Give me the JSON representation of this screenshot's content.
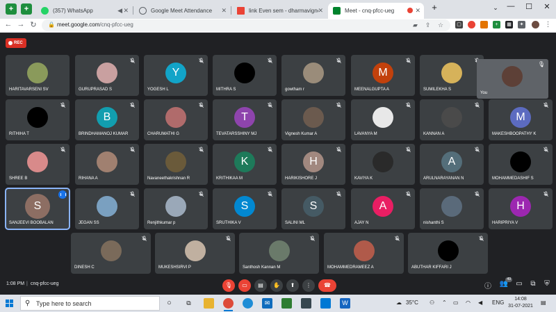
{
  "browser": {
    "tabs": [
      {
        "label": "(357) WhatsApp",
        "favicon_color": "#25d366",
        "active": false
      },
      {
        "label": "Google Meet Attendance",
        "favicon_color": "#5f6368",
        "active": false
      },
      {
        "label": "link Even sem - dharmavigneshg",
        "favicon_color": "#ea4335",
        "active": false
      },
      {
        "label": "Meet - cnq-pfcc-ueg",
        "favicon_color": "#00832d",
        "active": true
      }
    ],
    "new_tab": "+",
    "url_host": "meet.google.com",
    "url_path": "/cnq-pfcc-ueg"
  },
  "meet": {
    "recording_label": "REC",
    "self_label": "You",
    "meeting_time": "1:08 PM",
    "separator": "|",
    "meeting_code": "cnq-pfcc-ueg",
    "participants_count": "49",
    "participants": [
      {
        "name": "HARITAVARSENI SV",
        "avatar": "",
        "color": "#8a9a5b",
        "photo": true,
        "muted": false
      },
      {
        "name": "GURUPRASAD S",
        "avatar": "",
        "color": "#c9a0a0",
        "photo": true,
        "muted": true
      },
      {
        "name": "YOGESH L",
        "avatar": "Y",
        "color": "#12a4c8",
        "photo": false,
        "muted": true
      },
      {
        "name": "MITHRA S",
        "avatar": "",
        "color": "#000000",
        "photo": true,
        "muted": true
      },
      {
        "name": "gowtham r",
        "avatar": "",
        "color": "#9a8c7a",
        "photo": true,
        "muted": true
      },
      {
        "name": "MEENALGUPTA A",
        "avatar": "M",
        "color": "#c2410c",
        "photo": false,
        "muted": true
      },
      {
        "name": "SUMILEKHA S",
        "avatar": "",
        "color": "#d6b25a",
        "photo": true,
        "muted": true
      },
      {
        "name": "RITHIHA T",
        "avatar": "",
        "color": "#000000",
        "photo": true,
        "muted": true
      },
      {
        "name": "BRINDHAMANOJ KUMAR",
        "avatar": "B",
        "color": "#129eaf",
        "photo": false,
        "muted": true
      },
      {
        "name": "CHARUMATHI G",
        "avatar": "",
        "color": "#b06b6b",
        "photo": true,
        "muted": true
      },
      {
        "name": "TEVATARSSHINY MJ",
        "avatar": "T",
        "color": "#8e44ad",
        "photo": false,
        "muted": true
      },
      {
        "name": "Vignesh Kumar A",
        "avatar": "",
        "color": "#6b5a4e",
        "photo": true,
        "muted": true
      },
      {
        "name": "LAVANYA M",
        "avatar": "",
        "color": "#e8e8e8",
        "photo": true,
        "muted": true
      },
      {
        "name": "KANNAN A",
        "avatar": "",
        "color": "#4a4a4a",
        "photo": true,
        "muted": true
      },
      {
        "name": "MAKESHBOOPATHY K",
        "avatar": "M",
        "color": "#5c6bc0",
        "photo": false,
        "muted": true
      },
      {
        "name": "SHREE B",
        "avatar": "",
        "color": "#d88a8a",
        "photo": true,
        "muted": true
      },
      {
        "name": "RIHANA A",
        "avatar": "",
        "color": "#a08070",
        "photo": true,
        "muted": true
      },
      {
        "name": "Navaneethakrishnan R",
        "avatar": "",
        "color": "#6a5a3a",
        "photo": true,
        "muted": true
      },
      {
        "name": "KRITHIKAA M",
        "avatar": "K",
        "color": "#1e7a5a",
        "photo": false,
        "muted": true
      },
      {
        "name": "HARIKISHORE J",
        "avatar": "H",
        "color": "#a1887f",
        "photo": false,
        "muted": true
      },
      {
        "name": "KAVIYA K",
        "avatar": "",
        "color": "#2a2a2a",
        "photo": true,
        "muted": true
      },
      {
        "name": "ARULNARAYANAN N",
        "avatar": "A",
        "color": "#546e7a",
        "photo": false,
        "muted": true
      },
      {
        "name": "MOHAMMEDASHIF S",
        "avatar": "",
        "color": "#000000",
        "photo": true,
        "muted": true
      },
      {
        "name": "SANJEEVI BOOBALAN",
        "avatar": "S",
        "color": "#8d6e63",
        "photo": false,
        "muted": false,
        "speaking": true
      },
      {
        "name": "JEGAN SS",
        "avatar": "",
        "color": "#7aa0c0",
        "photo": true,
        "muted": true
      },
      {
        "name": "Renjithkumar p",
        "avatar": "",
        "color": "#9aa8b8",
        "photo": true,
        "muted": true
      },
      {
        "name": "SRUTHIKA V",
        "avatar": "S",
        "color": "#0288d1",
        "photo": false,
        "muted": true
      },
      {
        "name": "SALINI ML",
        "avatar": "S",
        "color": "#455a64",
        "photo": false,
        "muted": true
      },
      {
        "name": "AJAY N",
        "avatar": "A",
        "color": "#e91e63",
        "photo": false,
        "muted": true
      },
      {
        "name": "nishanthi S",
        "avatar": "",
        "color": "#5a6a7a",
        "photo": true,
        "muted": true
      },
      {
        "name": "HARIPRIYA V",
        "avatar": "H",
        "color": "#9c27b0",
        "photo": false,
        "muted": true
      },
      {
        "name": "DINESH C",
        "avatar": "",
        "color": "#7a6a5a",
        "photo": true,
        "muted": true
      },
      {
        "name": "MUKESHSIRVI P",
        "avatar": "",
        "color": "#c0b0a0",
        "photo": true,
        "muted": true
      },
      {
        "name": "Santhosh Kannan M",
        "avatar": "",
        "color": "#6a7a6a",
        "photo": true,
        "muted": true
      },
      {
        "name": "MOHAMMEDRAMEEZ A",
        "avatar": "",
        "color": "#b05a4a",
        "photo": true,
        "muted": true
      },
      {
        "name": "ABUTHAR KIFFARI J",
        "avatar": "",
        "color": "#000000",
        "photo": true,
        "muted": true
      }
    ]
  },
  "taskbar": {
    "search_placeholder": "Type here to search",
    "weather": "35°C",
    "language": "ENG",
    "time": "14:08",
    "date": "31-07-2021"
  }
}
